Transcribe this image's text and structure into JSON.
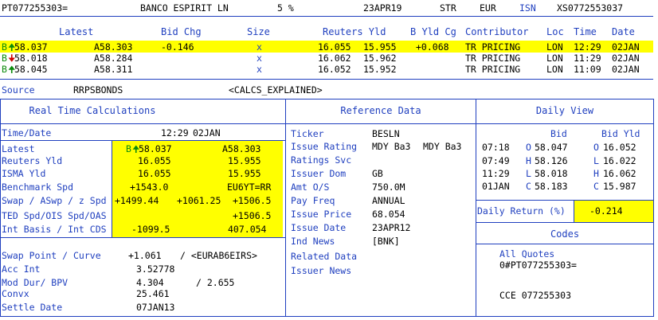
{
  "top": {
    "ric": "PT077255303=",
    "issuer": "BANCO ESPIRIT LN",
    "coupon": "5 %",
    "maturity": "23APR19",
    "type": "STR",
    "currency": "EUR",
    "isn_label": "ISN",
    "isin": "XS0772553037"
  },
  "quote_header": {
    "latest": "Latest",
    "bid_chg": "Bid Chg",
    "size": "Size",
    "reuters_yld": "Reuters Yld",
    "b_yld_cg": "B Yld Cg",
    "contributor": "Contributor",
    "loc": "Loc",
    "time": "Time",
    "date": "Date"
  },
  "quotes": [
    {
      "bid_prefix": "B",
      "dir": "up",
      "bid": "58.037",
      "ask": "A58.303",
      "bid_chg": "-0.146",
      "size": "x",
      "yld_bid": "16.055",
      "yld_ask": "15.955",
      "yld_chg": "+0.068",
      "contrib": "TR PRICING",
      "loc": "LON",
      "time": "12:29",
      "date": "02JAN"
    },
    {
      "bid_prefix": "B",
      "dir": "down",
      "bid": "58.018",
      "ask": "A58.284",
      "bid_chg": "",
      "size": "x",
      "yld_bid": "16.062",
      "yld_ask": "15.962",
      "yld_chg": "",
      "contrib": "TR PRICING",
      "loc": "LON",
      "time": "11:29",
      "date": "02JAN"
    },
    {
      "bid_prefix": "B",
      "dir": "up",
      "bid": "58.045",
      "ask": "A58.311",
      "bid_chg": "",
      "size": "x",
      "yld_bid": "16.052",
      "yld_ask": "15.952",
      "yld_chg": "",
      "contrib": "TR PRICING",
      "loc": "LON",
      "time": "11:09",
      "date": "02JAN"
    }
  ],
  "source_line": {
    "label": "Source",
    "value": "RRPSBONDS",
    "calcs": "<CALCS_EXPLAINED>"
  },
  "rtc": {
    "title": "Real Time Calculations",
    "time_date_label": "Time/Date",
    "time": "12:29",
    "date": "02JAN",
    "latest_label": "Latest",
    "latest_bid": "58.037",
    "latest_ask": "A58.303",
    "reuters_yld_label": "Reuters Yld",
    "reuters_yld_bid": "16.055",
    "reuters_yld_ask": "15.955",
    "isma_yld_label": "ISMA Yld",
    "isma_yld_bid": "16.055",
    "isma_yld_ask": "15.955",
    "bmk_spd_label": "Benchmark Spd",
    "bmk_spd_value": "+1543.0",
    "bmk_spd_ref": "EU6YT=RR",
    "swap_label": "Swap / ASwp / z Spd",
    "swap_1": "+1499.44",
    "swap_2": "+1061.25",
    "swap_3": "+1506.5",
    "ted_label": "TED Spd/OIS Spd/OAS",
    "ted_value": "+1506.5",
    "int_label": "Int Basis / Int CDS",
    "int_basis": "-1099.5",
    "int_cds": "407.054",
    "swap_point_label": "Swap Point / Curve",
    "swap_point_value": "+1.061",
    "swap_curve": "/ <EURAB6EIRS>",
    "acc_int_label": "Acc Int",
    "acc_int_value": "3.52778",
    "mod_dur_label": "Mod Dur/ BPV",
    "mod_dur_value": "4.304",
    "bpv_value": "/ 2.655",
    "convx_label": "Convx",
    "convx_value": "25.461",
    "settle_label": "Settle Date",
    "settle_value": "07JAN13"
  },
  "ref": {
    "title": "Reference Data",
    "rows": [
      {
        "label": "Ticker",
        "value": "BESLN",
        "value2": ""
      },
      {
        "label": "Issue Rating",
        "value": "MDY Ba3",
        "value2": "MDY Ba3"
      },
      {
        "label": "Ratings Svc",
        "value": "",
        "value2": ""
      },
      {
        "label": "Issuer Dom",
        "value": "GB",
        "value2": ""
      },
      {
        "label": "Amt O/S",
        "value": "750.0M",
        "value2": ""
      },
      {
        "label": "Pay Freq",
        "value": "ANNUAL",
        "value2": ""
      },
      {
        "label": "Issue Price",
        "value": "68.054",
        "value2": ""
      },
      {
        "label": "Issue Date",
        "value": "23APR12",
        "value2": ""
      },
      {
        "label": "Ind News",
        "value": "[BNK]",
        "value2": ""
      },
      {
        "label": "Related Data",
        "value": "",
        "value2": ""
      },
      {
        "label": "Issuer News",
        "value": "",
        "value2": ""
      }
    ]
  },
  "daily": {
    "title": "Daily View",
    "bid_hdr": "Bid",
    "yld_hdr": "Bid Yld",
    "rows": [
      {
        "t": "07:18",
        "pl": "O",
        "p": "58.047",
        "yl": "O",
        "y": "16.052"
      },
      {
        "t": "07:49",
        "pl": "H",
        "p": "58.126",
        "yl": "L",
        "y": "16.022"
      },
      {
        "t": "11:29",
        "pl": "L",
        "p": "58.018",
        "yl": "H",
        "y": "16.062"
      },
      {
        "t": "01JAN",
        "pl": "C",
        "p": "58.183",
        "yl": "C",
        "y": "15.987"
      }
    ],
    "daily_return_label": "Daily Return (%)",
    "daily_return_value": "-0.214"
  },
  "codes": {
    "title": "Codes",
    "all_quotes": "All Quotes",
    "ric": "0#PT077255303=",
    "cce": "CCE 077255303"
  }
}
